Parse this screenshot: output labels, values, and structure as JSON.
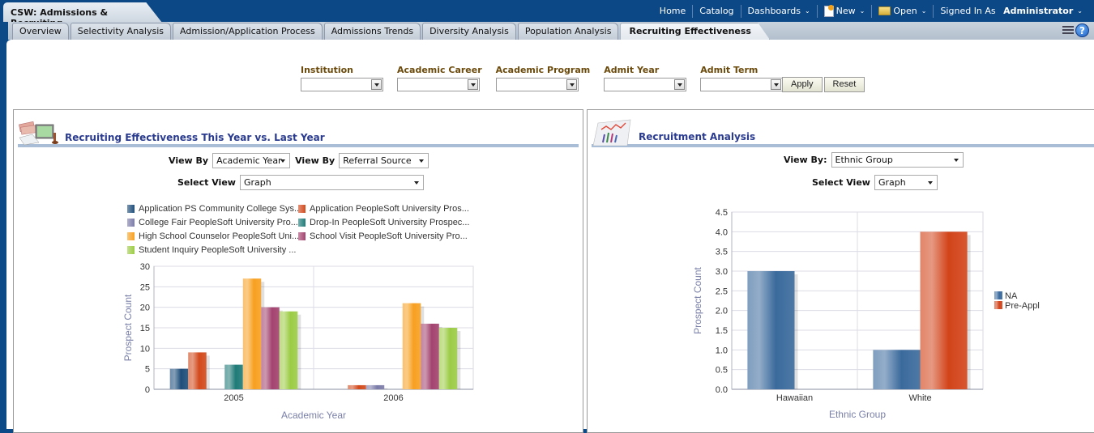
{
  "header": {
    "dashboard_title": "CSW: Admissions & Recruiting",
    "nav": {
      "home": "Home",
      "catalog": "Catalog",
      "dashboards": "Dashboards",
      "new": "New",
      "open": "Open",
      "signed_in_as": "Signed In As",
      "user": "Administrator"
    }
  },
  "tabs": [
    {
      "label": "Overview",
      "active": false
    },
    {
      "label": "Selectivity Analysis",
      "active": false
    },
    {
      "label": "Admission/Application Process",
      "active": false
    },
    {
      "label": "Admissions Trends",
      "active": false
    },
    {
      "label": "Diversity Analysis",
      "active": false
    },
    {
      "label": "Population Analysis",
      "active": false
    },
    {
      "label": "Recruiting Effectiveness",
      "active": true
    }
  ],
  "prompts": {
    "fields": [
      {
        "label": "Institution",
        "value": ""
      },
      {
        "label": "Academic Career",
        "value": ""
      },
      {
        "label": "Academic Program",
        "value": ""
      },
      {
        "label": "Admit Year",
        "value": ""
      },
      {
        "label": "Admit Term",
        "value": ""
      }
    ],
    "apply_label": "Apply",
    "reset_label": "Reset"
  },
  "left_panel": {
    "title": "Recruiting Effectiveness This Year vs. Last Year",
    "view_by_label": "View By",
    "view_by_1": "Academic Year",
    "view_by_2_label": "View By",
    "view_by_2": "Referral Source",
    "select_view_label": "Select View",
    "select_view": "Graph"
  },
  "right_panel": {
    "title": "Recruitment Analysis",
    "view_by_label": "View By:",
    "view_by": "Ethnic Group",
    "select_view_label": "Select View",
    "select_view": "Graph"
  },
  "chart_data": [
    {
      "type": "bar",
      "title": "Recruiting Effectiveness This Year vs. Last Year",
      "xlabel": "Academic Year",
      "ylabel": "Prospect Count",
      "categories": [
        "2005",
        "2006"
      ],
      "ylim": [
        0,
        30
      ],
      "yticks": [
        0,
        5,
        10,
        15,
        20,
        25,
        30
      ],
      "grid": true,
      "legend_position": "top",
      "series": [
        {
          "name": "Application PS Community College Sys...",
          "color": "#1f4e7a",
          "values": [
            5,
            0
          ]
        },
        {
          "name": "Application PeopleSoft University Pros...",
          "color": "#d24a1c",
          "values": [
            9,
            1
          ]
        },
        {
          "name": "College Fair PeopleSoft University Pro...",
          "color": "#7b7ba8",
          "values": [
            0,
            1
          ]
        },
        {
          "name": "Drop-In PeopleSoft University Prospec...",
          "color": "#1f7b78",
          "values": [
            6,
            0
          ]
        },
        {
          "name": "High School Counselor PeopleSoft Uni...",
          "color": "#f7a021",
          "values": [
            27,
            21
          ]
        },
        {
          "name": "School Visit PeopleSoft University Pro...",
          "color": "#a3436f",
          "values": [
            20,
            16
          ]
        },
        {
          "name": "Student Inquiry PeopleSoft University ...",
          "color": "#9ccc45",
          "values": [
            19,
            15
          ]
        }
      ]
    },
    {
      "type": "bar",
      "title": "Recruitment Analysis",
      "xlabel": "Ethnic Group",
      "ylabel": "Prospect Count",
      "categories": [
        "Hawaiian",
        "White"
      ],
      "ylim": [
        0,
        4.5
      ],
      "yticks": [
        0.0,
        0.5,
        1.0,
        1.5,
        2.0,
        2.5,
        3.0,
        3.5,
        4.0,
        4.5
      ],
      "grid": true,
      "legend_position": "right",
      "series": [
        {
          "name": "NA",
          "color": "#3a6a9c",
          "values": [
            3.0,
            1.0
          ]
        },
        {
          "name": "Pre-Appl",
          "color": "#d2441a",
          "values": [
            0,
            4.0
          ]
        }
      ]
    }
  ]
}
